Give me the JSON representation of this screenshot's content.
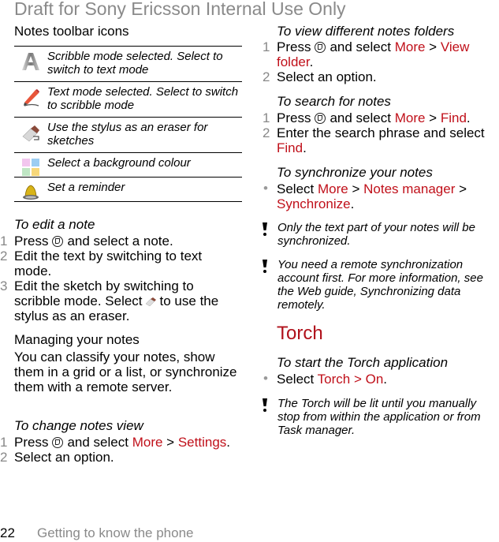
{
  "header": {
    "draft_label": "Draft for Sony Ericsson Internal Use Only"
  },
  "left": {
    "toolbar_title": "Notes toolbar icons",
    "toolbar_icons": [
      {
        "icon": "scribble-mode-icon",
        "desc": "Scribble mode selected. Select to switch to text mode"
      },
      {
        "icon": "text-mode-icon",
        "desc": "Text mode selected. Select to switch to scribble mode"
      },
      {
        "icon": "eraser-icon",
        "desc": "Use the stylus as an eraser for sketches"
      },
      {
        "icon": "background-colour-icon",
        "desc": "Select a background colour"
      },
      {
        "icon": "reminder-bell-icon",
        "desc": "Set a reminder"
      }
    ],
    "edit_note": {
      "title": "To edit a note",
      "steps": [
        {
          "n": "1",
          "pre": "Press",
          "post": "and select a note."
        },
        {
          "n": "2",
          "text": "Edit the text by switching to text mode."
        },
        {
          "n": "3",
          "pre": "Edit the sketch by switching to scribble mode. Select",
          "post": "to use the stylus as an eraser."
        }
      ]
    },
    "managing": {
      "title": "Managing your notes",
      "body": "You can classify your notes, show them in a grid or a list, or synchronize them with a remote server."
    },
    "change_view": {
      "title": "To change notes view",
      "steps": [
        {
          "n": "1",
          "pre": "Press",
          "mid": "and select",
          "link1": "More",
          "sep": ">",
          "link2": "Settings",
          "end": "."
        },
        {
          "n": "2",
          "text": "Select an option."
        }
      ]
    }
  },
  "right": {
    "view_folders": {
      "title": "To view different notes folders",
      "steps": [
        {
          "n": "1",
          "pre": "Press",
          "mid": "and select",
          "link1": "More",
          "sep": ">",
          "link2": "View folder",
          "end": "."
        },
        {
          "n": "2",
          "text": "Select an option."
        }
      ]
    },
    "search": {
      "title": "To search for notes",
      "steps": [
        {
          "n": "1",
          "pre": "Press",
          "mid": "and select",
          "link1": "More",
          "sep": ">",
          "link2": "Find",
          "end": "."
        },
        {
          "n": "2",
          "pre": "Enter the search phrase and select",
          "link": "Find",
          "end": "."
        }
      ]
    },
    "sync": {
      "title": "To synchronize your notes",
      "bullet": {
        "pre": "Select",
        "link1": "More",
        "sep1": ">",
        "link2": "Notes manager",
        "sep2": ">",
        "link3": "Synchronize",
        "end": "."
      },
      "notes": [
        "Only the text part of your notes will be synchronized.",
        "You need a remote synchronization account first. For more information, see the Web guide, Synchronizing data remotely."
      ]
    },
    "torch": {
      "heading": "Torch",
      "title": "To start the Torch application",
      "bullet": {
        "pre": "Select",
        "link": "Torch > On",
        "end": "."
      },
      "note": "The Torch will be lit until you manually stop from within the application or from Task manager."
    }
  },
  "footer": {
    "page_number": "22",
    "section": "Getting to know the phone"
  },
  "colors": {
    "link_red": "#c0101a",
    "heading_red": "#b0101a",
    "gray_text": "#8a8a8a"
  }
}
